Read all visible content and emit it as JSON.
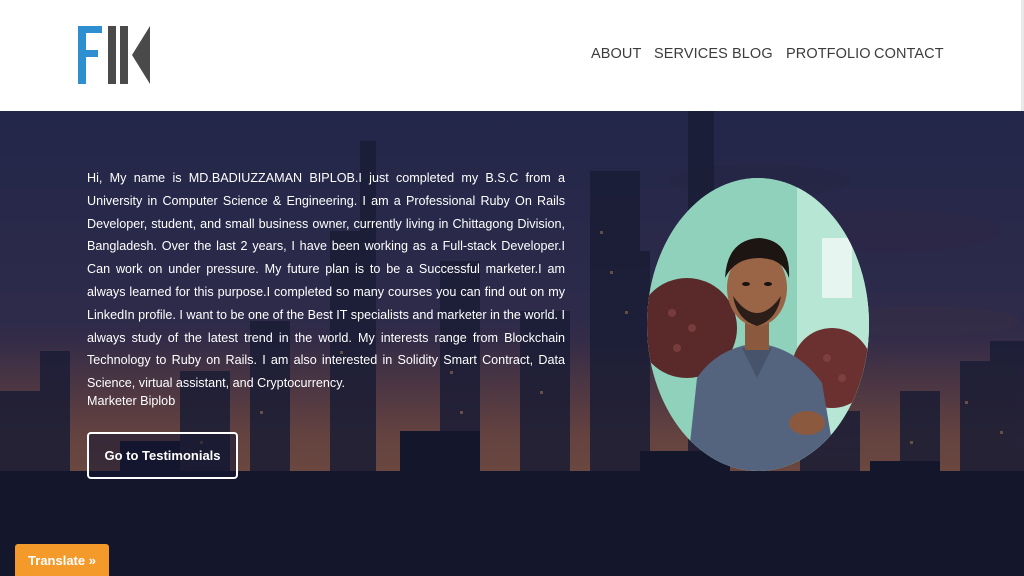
{
  "header": {
    "nav": [
      {
        "label": "ABOUT"
      },
      {
        "label": "SERVICES"
      },
      {
        "label": "BLOG"
      },
      {
        "label": "PROTFOLIO"
      },
      {
        "label": "CONTACT"
      }
    ]
  },
  "hero": {
    "bio": "Hi, My name is MD.BADIUZZAMAN BIPLOB.I just completed my B.S.C from a University in Computer Science & Engineering.  I am a Professional Ruby On Rails Developer, student, and small business owner, currently living in Chittagong Division, Bangladesh. Over the last 2 years, I have been working as a Full-stack Developer.I Can work on under pressure.  My future plan is to be a Successful marketer.I am always learned for this purpose.I completed so many courses you can find out on my LinkedIn profile. I want to be one of the Best  IT specialists and marketer in the world. I always study of the latest trend in the world.   My interests range from Blockchain Technology to Ruby on Rails. I am also interested in Solidity Smart Contract, Data Science, virtual assistant, and Cryptocurrency.",
    "signature": "Marketer Biplob",
    "cta_label": "Go to Testimonials"
  },
  "translate_label": "Translate »",
  "colors": {
    "logo_blue": "#2e8fd0",
    "logo_gray": "#4a4a4a",
    "translate_bg": "#f39a2a",
    "nav_text": "#3c3c3c"
  },
  "icons": {
    "logo": "fk-logo"
  }
}
